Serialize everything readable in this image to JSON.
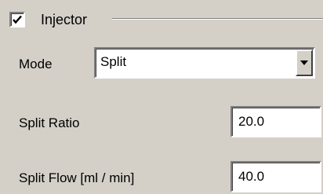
{
  "injector": {
    "enabled": true,
    "title": "Injector"
  },
  "mode": {
    "label": "Mode",
    "value": "Split",
    "dropdown_icon": "triangle-down-icon"
  },
  "split_ratio": {
    "label": "Split Ratio",
    "value": "20.0"
  },
  "split_flow": {
    "label": "Split Flow [ml / min]",
    "value": "40.0"
  },
  "checkbox_icon": "checkmark-icon"
}
